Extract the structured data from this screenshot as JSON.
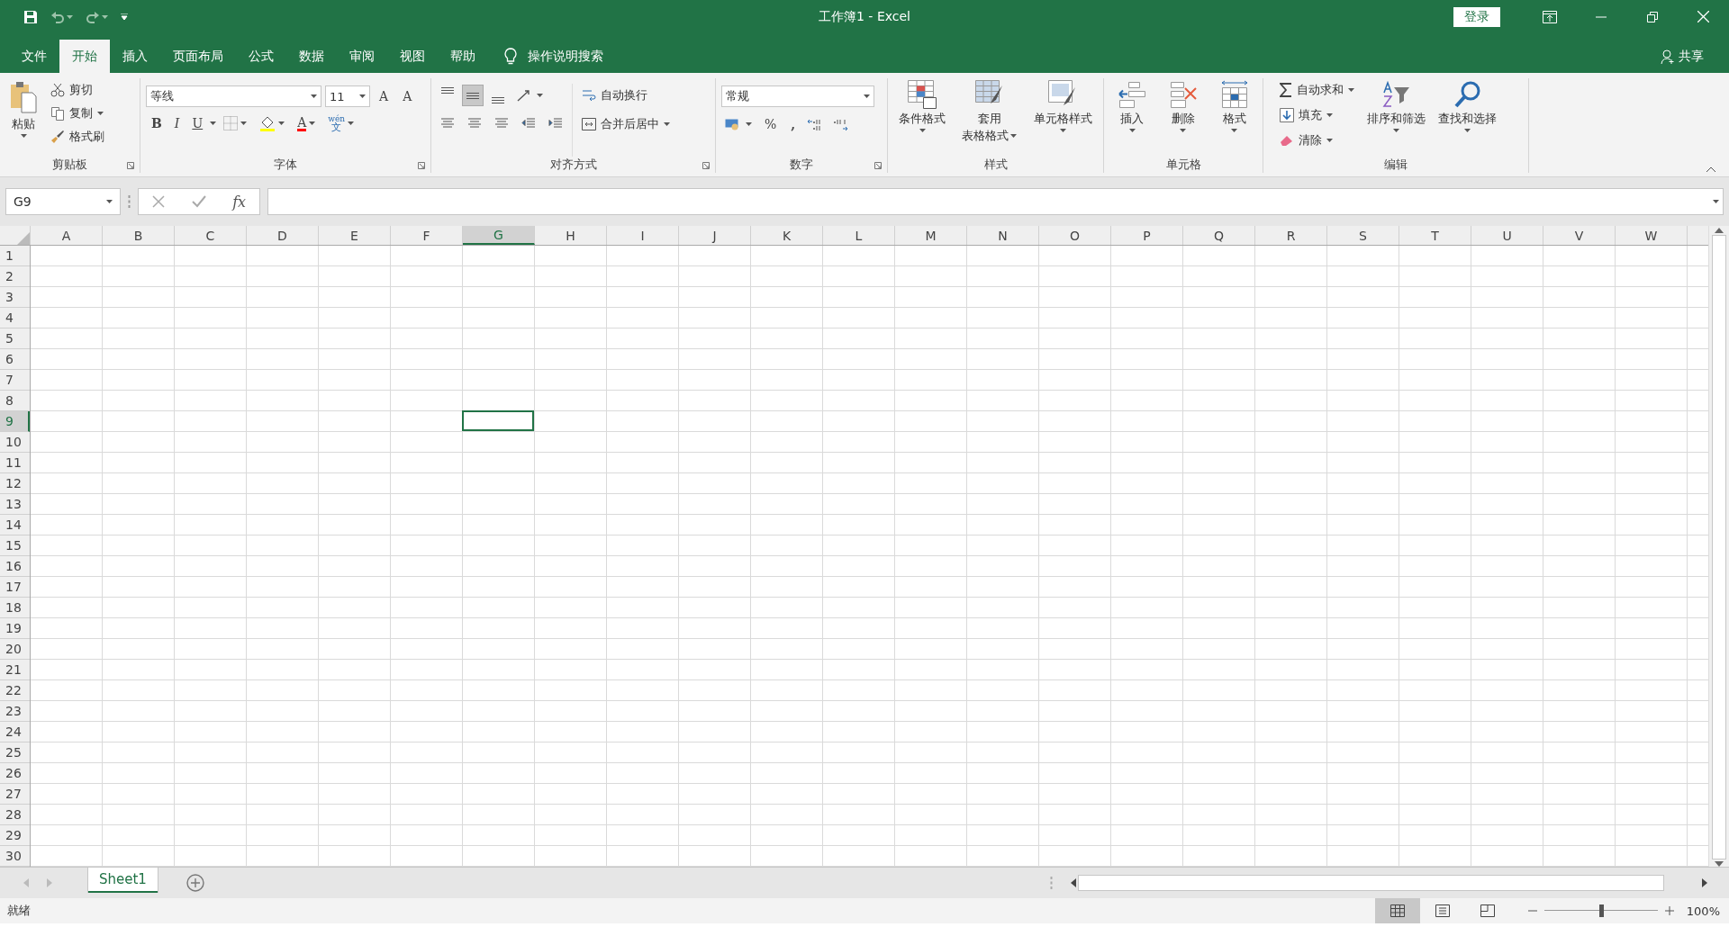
{
  "title_bar": {
    "title": "工作簿1  -  Excel",
    "sign_in": "登录"
  },
  "menu_tabs": [
    {
      "label": "文件",
      "selected": false
    },
    {
      "label": "开始",
      "selected": true
    },
    {
      "label": "插入",
      "selected": false
    },
    {
      "label": "页面布局",
      "selected": false
    },
    {
      "label": "公式",
      "selected": false
    },
    {
      "label": "数据",
      "selected": false
    },
    {
      "label": "审阅",
      "selected": false
    },
    {
      "label": "视图",
      "selected": false
    },
    {
      "label": "帮助",
      "selected": false
    }
  ],
  "tell_me": "操作说明搜索",
  "share": "共享",
  "ribbon": {
    "clipboard": {
      "label": "剪贴板",
      "paste": "粘贴",
      "cut": "剪切",
      "copy": "复制",
      "format_painter": "格式刷"
    },
    "font": {
      "label": "字体",
      "font_name": "等线",
      "font_size": "11",
      "grow": "A",
      "shrink": "A",
      "bold": "B",
      "italic": "I",
      "underline": "U",
      "font_color": "A",
      "phonetic_top": "wén",
      "phonetic_bottom": "文"
    },
    "alignment": {
      "label": "对齐方式",
      "vertical_align": [
        {
          "kind": "top",
          "selected": false
        },
        {
          "kind": "middle",
          "selected": true
        },
        {
          "kind": "bottom",
          "selected": false
        }
      ],
      "wrap_text": "自动换行",
      "merge_center": "合并后居中"
    },
    "number": {
      "label": "数字",
      "format": "常规",
      "percent": "%",
      "comma": ","
    },
    "styles": {
      "label": "样式",
      "conditional": "条件格式",
      "table_line1": "套用",
      "table_line2": "表格格式",
      "cell_styles": "单元格样式"
    },
    "cells": {
      "label": "单元格",
      "insert": "插入",
      "delete": "删除",
      "format": "格式"
    },
    "editing": {
      "label": "编辑",
      "autosum": "自动求和",
      "fill": "填充",
      "clear": "清除",
      "sort": "排序和筛选",
      "find": "查找和选择"
    }
  },
  "formula_bar": {
    "name_box": "G9",
    "fx": "fx"
  },
  "columns": [
    {
      "label": "A",
      "selected": false
    },
    {
      "label": "B",
      "selected": false
    },
    {
      "label": "C",
      "selected": false
    },
    {
      "label": "D",
      "selected": false
    },
    {
      "label": "E",
      "selected": false
    },
    {
      "label": "F",
      "selected": false
    },
    {
      "label": "G",
      "selected": true
    },
    {
      "label": "H",
      "selected": false
    },
    {
      "label": "I",
      "selected": false
    },
    {
      "label": "J",
      "selected": false
    },
    {
      "label": "K",
      "selected": false
    },
    {
      "label": "L",
      "selected": false
    },
    {
      "label": "M",
      "selected": false
    },
    {
      "label": "N",
      "selected": false
    },
    {
      "label": "O",
      "selected": false
    },
    {
      "label": "P",
      "selected": false
    },
    {
      "label": "Q",
      "selected": false
    },
    {
      "label": "R",
      "selected": false
    },
    {
      "label": "S",
      "selected": false
    },
    {
      "label": "T",
      "selected": false
    },
    {
      "label": "U",
      "selected": false
    },
    {
      "label": "V",
      "selected": false
    },
    {
      "label": "W",
      "selected": false
    }
  ],
  "rows": [
    {
      "label": "1",
      "selected": false
    },
    {
      "label": "2",
      "selected": false
    },
    {
      "label": "3",
      "selected": false
    },
    {
      "label": "4",
      "selected": false
    },
    {
      "label": "5",
      "selected": false
    },
    {
      "label": "6",
      "selected": false
    },
    {
      "label": "7",
      "selected": false
    },
    {
      "label": "8",
      "selected": false
    },
    {
      "label": "9",
      "selected": true
    },
    {
      "label": "10",
      "selected": false
    },
    {
      "label": "11",
      "selected": false
    },
    {
      "label": "12",
      "selected": false
    },
    {
      "label": "13",
      "selected": false
    },
    {
      "label": "14",
      "selected": false
    },
    {
      "label": "15",
      "selected": false
    },
    {
      "label": "16",
      "selected": false
    },
    {
      "label": "17",
      "selected": false
    },
    {
      "label": "18",
      "selected": false
    },
    {
      "label": "19",
      "selected": false
    },
    {
      "label": "20",
      "selected": false
    },
    {
      "label": "21",
      "selected": false
    },
    {
      "label": "22",
      "selected": false
    },
    {
      "label": "23",
      "selected": false
    },
    {
      "label": "24",
      "selected": false
    },
    {
      "label": "25",
      "selected": false
    },
    {
      "label": "26",
      "selected": false
    },
    {
      "label": "27",
      "selected": false
    },
    {
      "label": "28",
      "selected": false
    },
    {
      "label": "29",
      "selected": false
    },
    {
      "label": "30",
      "selected": false
    }
  ],
  "sheets": [
    {
      "label": "Sheet1",
      "selected": true
    }
  ],
  "status_bar": {
    "status": "就绪",
    "views": [
      {
        "kind": "normal",
        "selected": true
      },
      {
        "kind": "page_layout",
        "selected": false
      },
      {
        "kind": "page_break",
        "selected": false
      }
    ],
    "zoom": {
      "level": 0.5,
      "reading": "100%"
    }
  }
}
